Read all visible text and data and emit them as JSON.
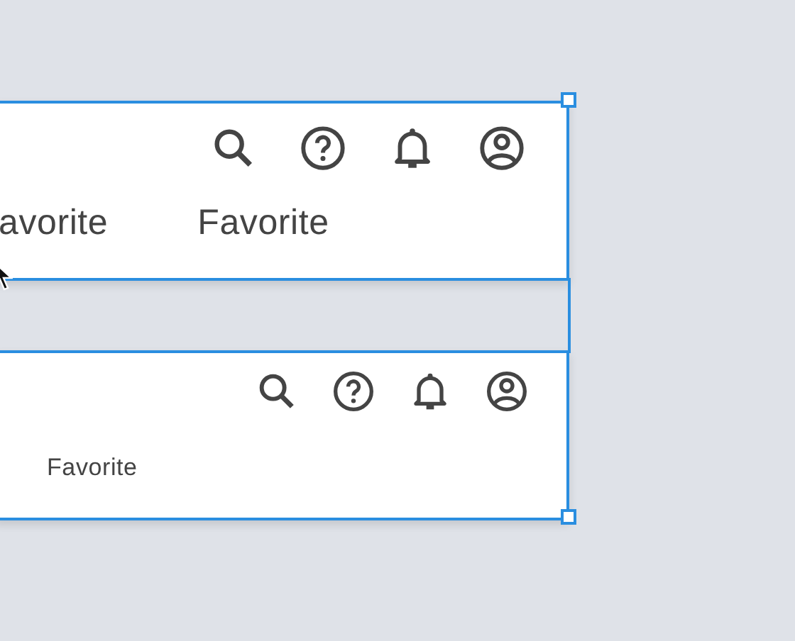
{
  "canvas": {
    "frames": [
      {
        "kind": "large",
        "selected": true,
        "labels": [
          "avorite",
          "Favorite"
        ]
      },
      {
        "kind": "small",
        "selected": true,
        "labels": [
          "Favorite"
        ]
      }
    ]
  }
}
